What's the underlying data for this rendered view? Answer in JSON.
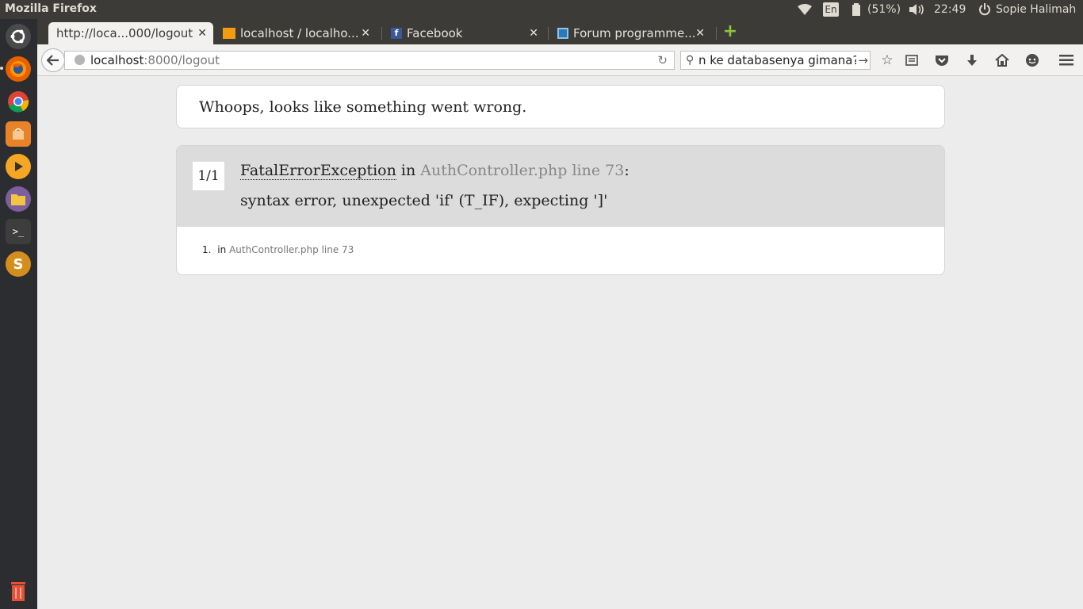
{
  "system_panel": {
    "app_title": "Mozilla Firefox",
    "language": "En",
    "battery": "(51%)",
    "clock": "22:49",
    "user": "Sopie Halimah"
  },
  "launcher": {
    "items": [
      "ubuntu-dash",
      "firefox",
      "chrome",
      "software-center",
      "media-player",
      "files",
      "terminal",
      "sublime-text",
      "trash"
    ]
  },
  "tabs": [
    {
      "label": "http://loca...000/logout"
    },
    {
      "label": "localhost / localho..."
    },
    {
      "label": "Facebook"
    },
    {
      "label": "Forum programme..."
    }
  ],
  "navbar": {
    "url_host": "localhost",
    "url_rest": ":8000/logout",
    "search_value": "n ke databasenya gimana?"
  },
  "page": {
    "whoops": "Whoops, looks like something went wrong.",
    "counter": "1/1",
    "exception_class": "FatalErrorException",
    "in_word": " in ",
    "location": "AuthController.php line 73",
    "colon": ":",
    "message": "syntax error, unexpected 'if' (T_IF), expecting ']'",
    "trace_index": "1.",
    "trace_in": "in",
    "trace_location": "AuthController.php line 73"
  },
  "colors": {
    "panel": "#3c3b37",
    "launcher": "#2b2d30",
    "page_bg": "#ececec",
    "exception_head": "#dcdcdc"
  }
}
